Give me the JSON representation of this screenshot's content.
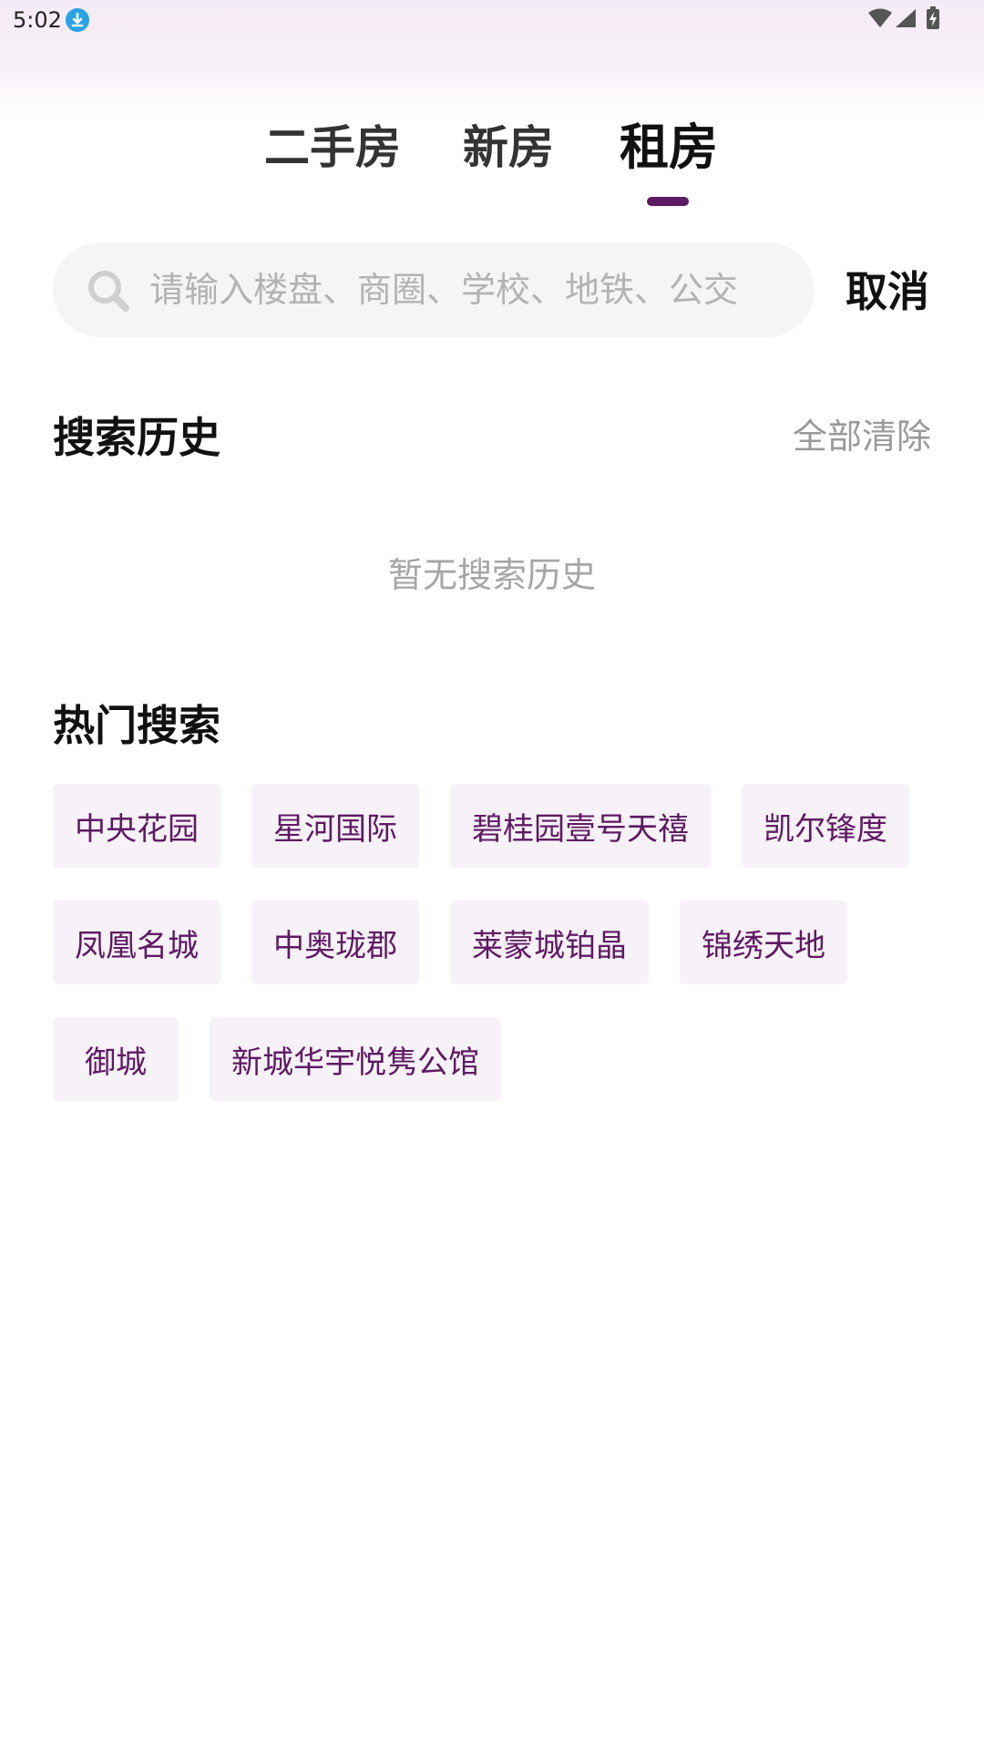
{
  "status_bar": {
    "time": "5:02",
    "icons": [
      "download-icon",
      "wifi-icon",
      "signal-icon",
      "battery-charging-icon"
    ]
  },
  "tabs": [
    {
      "label": "二手房",
      "active": false
    },
    {
      "label": "新房",
      "active": false
    },
    {
      "label": "租房",
      "active": true
    }
  ],
  "search": {
    "placeholder": "请输入楼盘、商圈、学校、地铁、公交",
    "value": "",
    "icon": "search-icon",
    "cancel_label": "取消"
  },
  "history": {
    "title": "搜索历史",
    "clear_label": "全部清除",
    "empty_text": "暂无搜索历史"
  },
  "hot": {
    "title": "热门搜索",
    "tags": [
      "中央花园",
      "星河国际",
      "碧桂园壹号天禧",
      "凯尔锋度",
      "凤凰名城",
      "中奥珑郡",
      "莱蒙城铂晶",
      "锦绣天地",
      "御城",
      "新城华宇悦隽公馆"
    ]
  },
  "colors": {
    "accent": "#5e1a63",
    "tag_background": "#f7f1f8",
    "search_background": "#f5f5f5",
    "muted_text": "#9a9a9a"
  }
}
